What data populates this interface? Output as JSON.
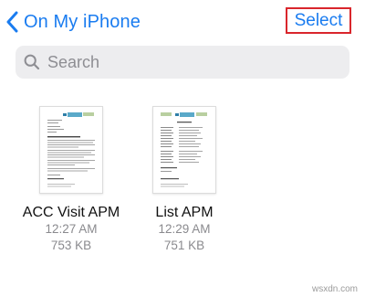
{
  "nav": {
    "back_label": "On My iPhone",
    "select_label": "Select",
    "accent_color": "#1a7cf0",
    "highlight_color": "#d9262c"
  },
  "search": {
    "placeholder": "Search",
    "value": ""
  },
  "files": [
    {
      "name": "ACC Visit APM",
      "time": "12:27 AM",
      "size": "753 KB",
      "icon": "pdf-document-thumbnail"
    },
    {
      "name": "List APM",
      "time": "12:29 AM",
      "size": "751 KB",
      "icon": "pdf-document-thumbnail"
    }
  ],
  "watermark": "wsxdn.com"
}
